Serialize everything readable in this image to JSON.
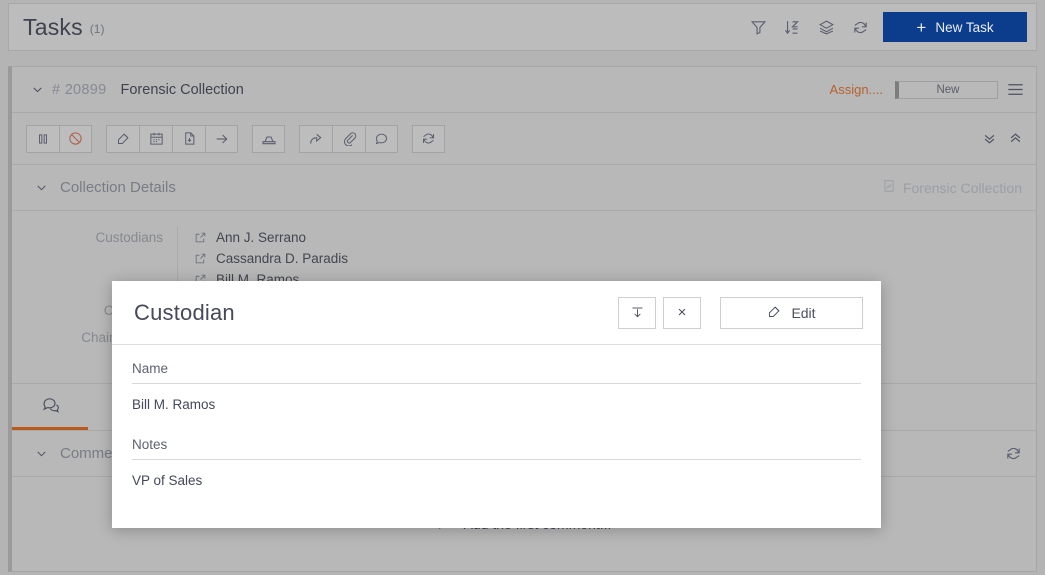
{
  "topbar": {
    "title": "Tasks",
    "count": "(1)",
    "icons": [
      {
        "name": "filter-icon",
        "label": "Filter"
      },
      {
        "name": "sort-az-icon",
        "label": "Sort"
      },
      {
        "name": "layers-icon",
        "label": "Group"
      },
      {
        "name": "refresh-icon",
        "label": "Refresh"
      }
    ],
    "new_task_label": "New Task",
    "new_task_plus": "+",
    "accent_color": "#0b3d8c"
  },
  "task": {
    "chevron": "⌄",
    "number": "# 20899",
    "name": "Forensic Collection",
    "assign_label": "Assign....",
    "assign_color": "#b5622f",
    "status": "New",
    "menu_icon": "hamburger-icon",
    "actions": [
      {
        "name": "pause-icon",
        "title": "Pause"
      },
      {
        "name": "block-icon",
        "title": "Cancel"
      },
      {
        "name": "edit-icon",
        "title": "Edit"
      },
      {
        "name": "calendar-icon",
        "title": "Schedule"
      },
      {
        "name": "document-icon",
        "title": "Document"
      },
      {
        "name": "arrow-right-icon",
        "title": "Move"
      },
      {
        "name": "archive-icon",
        "title": "Archive"
      },
      {
        "name": "share-icon",
        "title": "Forward"
      },
      {
        "name": "paperclip-icon",
        "title": "Attach"
      },
      {
        "name": "comment-icon",
        "title": "Comment"
      },
      {
        "name": "refresh-icon",
        "title": "Refresh"
      }
    ],
    "expand_all": "»",
    "collapse_all": "«"
  },
  "details": {
    "section_title": "Collection Details",
    "tag_label": "Forensic Collection",
    "custodians_label": "Custodians",
    "custodians": [
      "Ann J. Serrano",
      "Cassandra D. Paradis",
      "Bill M. Ramos"
    ],
    "collection_label": "Collection",
    "chain_label": "Chain of Cust"
  },
  "tabs": [
    {
      "name": "tab-comments",
      "icon": "comments-icon",
      "active": true
    }
  ],
  "comments": {
    "section_title": "Comme",
    "refresh_icon": "refresh-icon",
    "empty_label": "Add the first comment...",
    "active_underline_color": "#bc5a1c"
  },
  "modal": {
    "title": "Custodian",
    "dock_button": "dock-bottom-icon",
    "close_button": "×",
    "edit_label": "Edit",
    "fields": [
      {
        "label": "Name",
        "value": "Bill M. Ramos"
      },
      {
        "label": "Notes",
        "value": "VP of Sales"
      }
    ]
  }
}
